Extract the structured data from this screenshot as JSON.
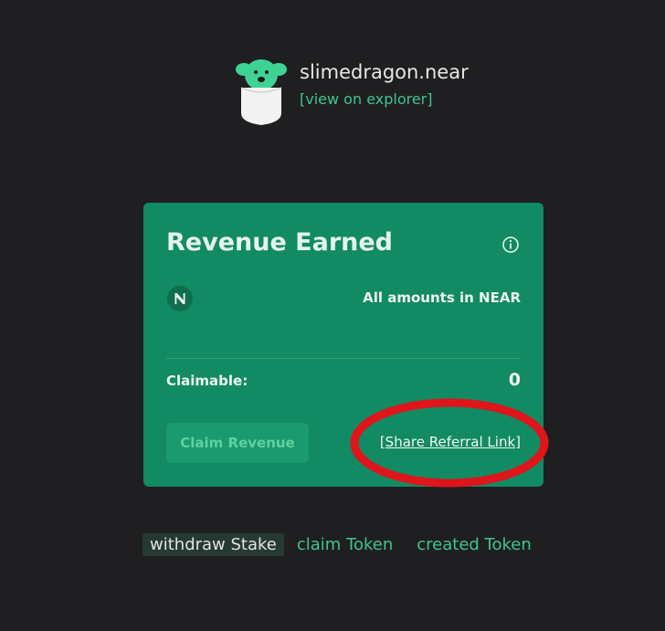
{
  "header": {
    "account_name": "slimedragon.near",
    "explorer_link": "[view on explorer]",
    "avatar_icon": "dog-in-pocket-avatar"
  },
  "card": {
    "title": "Revenue Earned",
    "amounts_note": "All amounts in NEAR",
    "claimable_label": "Claimable:",
    "claimable_value": "0",
    "claim_button": "Claim Revenue",
    "referral_link": "[Share Referral Link]",
    "info_icon": "info-icon",
    "currency_icon": "near-logo-icon"
  },
  "tabs": [
    {
      "label": "withdraw Stake",
      "active": true
    },
    {
      "label": "claim Token",
      "active": false
    },
    {
      "label": "created Token",
      "active": false
    }
  ],
  "colors": {
    "background": "#1f1f21",
    "card": "#128a63",
    "accent": "#3fc48f",
    "highlight": "#e0141b"
  }
}
